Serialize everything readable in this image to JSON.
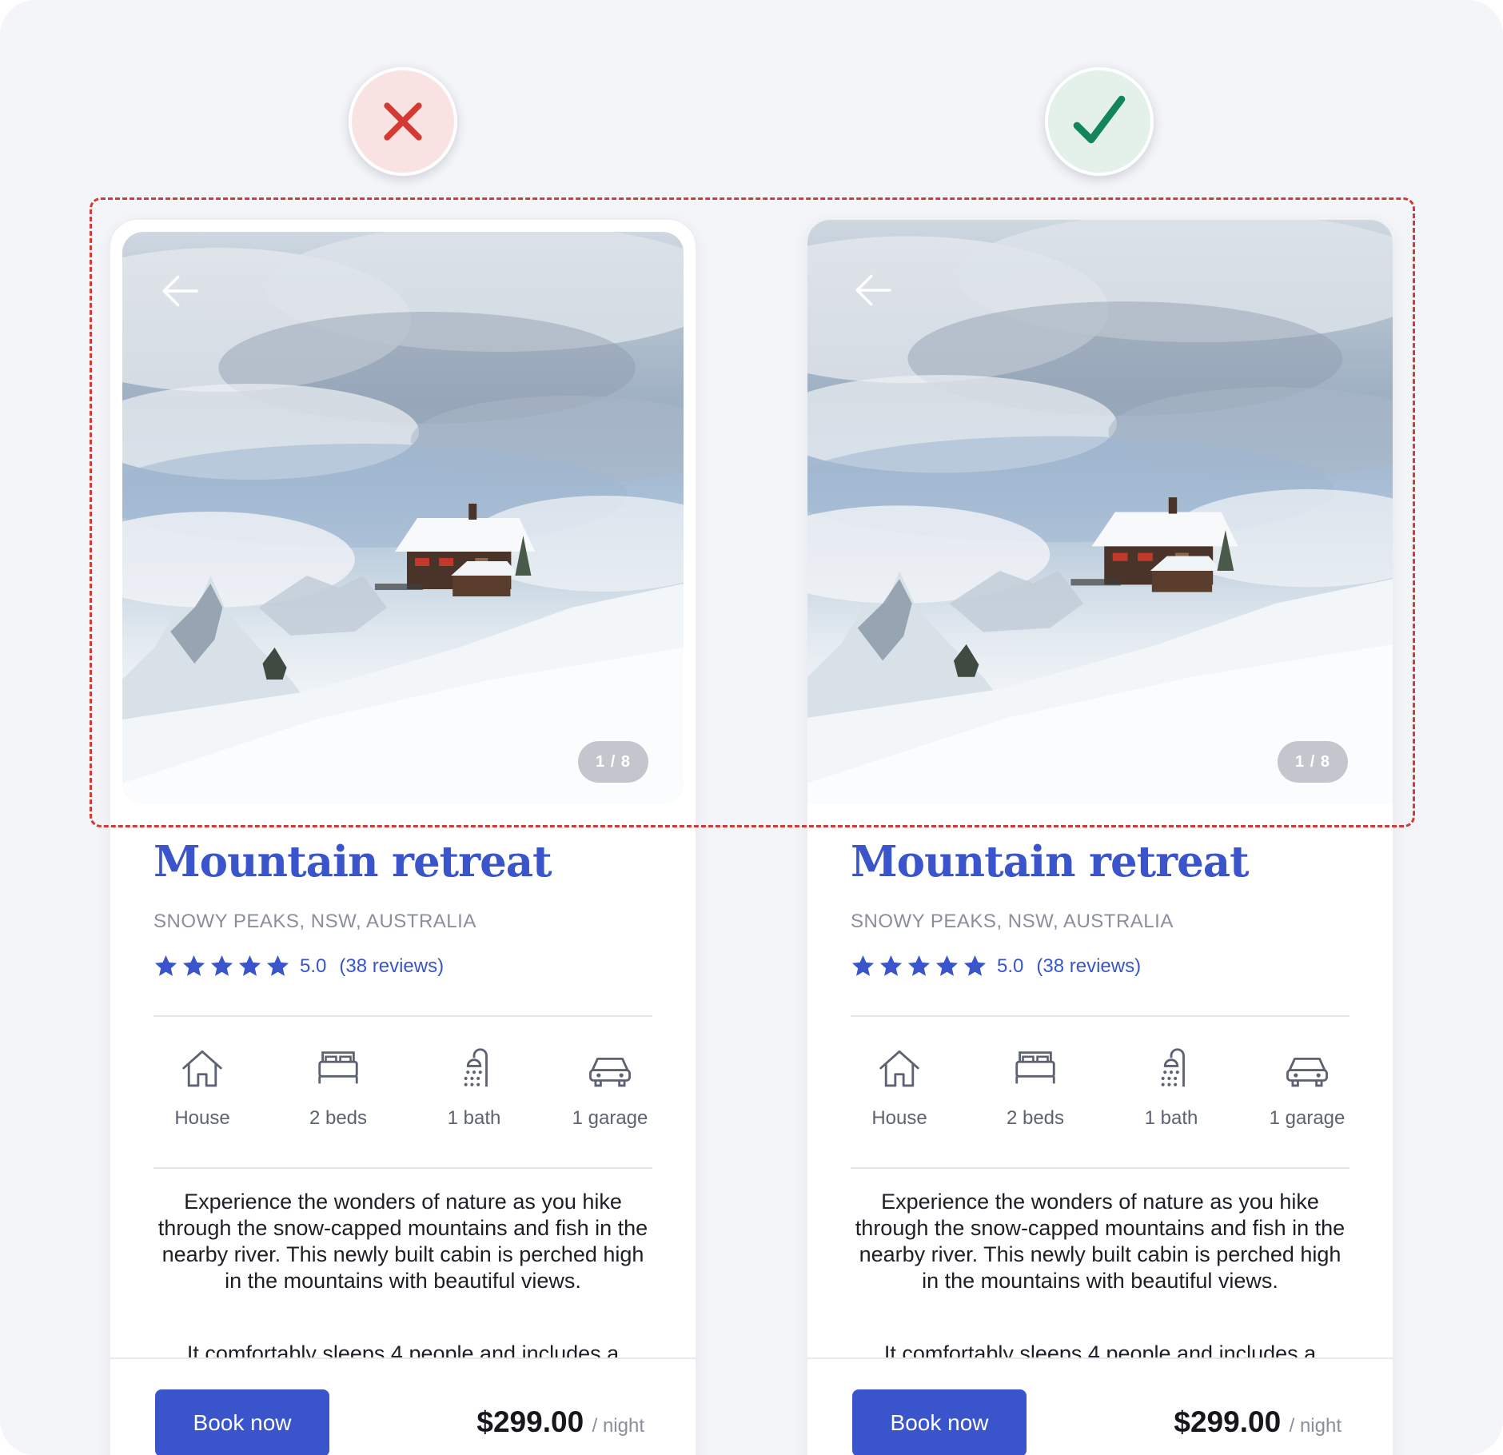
{
  "badges": {
    "bad": "close-icon",
    "good": "checkmark-icon",
    "bad_color": "#d23a33",
    "good_color": "#13855a"
  },
  "cards": [
    {
      "variant": "bad",
      "image_counter": "1 / 8",
      "title": "Mountain retreat",
      "location": "SNOWY PEAKS, NSW, AUSTRALIA",
      "rating_value": "5.0",
      "rating_count": "(38 reviews)",
      "features": [
        "House",
        "2 beds",
        "1 bath",
        "1 garage"
      ],
      "description": "Experience the wonders of nature as you hike through the snow-capped mountains and fish in the nearby river. This newly built cabin is perched high in the mountains with beautiful views.",
      "description_cut": "It comfortably sleeps 4 people and includes a",
      "book_label": "Book now",
      "price": "$299.00",
      "price_unit": "/ night"
    },
    {
      "variant": "good",
      "image_counter": "1 / 8",
      "title": "Mountain retreat",
      "location": "SNOWY PEAKS, NSW, AUSTRALIA",
      "rating_value": "5.0",
      "rating_count": "(38 reviews)",
      "features": [
        "House",
        "2 beds",
        "1 bath",
        "1 garage"
      ],
      "description": "Experience the wonders of nature as you hike through the snow-capped mountains and fish in the nearby river. This newly built cabin is perched high in the mountains with beautiful views.",
      "description_cut": "It comfortably sleeps 4 people and includes a",
      "book_label": "Book now",
      "price": "$299.00",
      "price_unit": "/ night"
    }
  ],
  "colors": {
    "accent": "#3a55cc",
    "highlight_border": "#d23a33",
    "muted_text": "#8a8f9c"
  }
}
